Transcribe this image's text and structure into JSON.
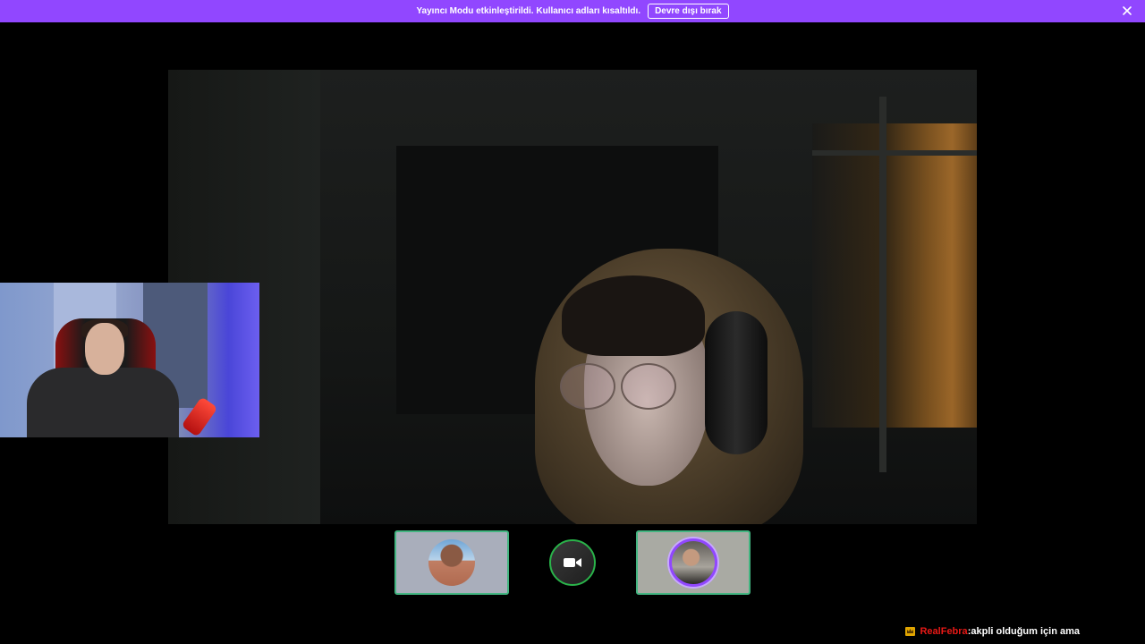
{
  "banner": {
    "message": "Yayıncı Modu etkinleştirildi. Kullanıcı adları kısaltıldı.",
    "disable_label": "Devre dışı bırak",
    "close_icon": "close-icon",
    "color": "#9147ff"
  },
  "participants": [
    {
      "id": "participant-1",
      "speaking": true
    },
    {
      "id": "participant-2",
      "video_icon": "video-camera-icon",
      "speaking": false
    },
    {
      "id": "participant-3",
      "speaking": true,
      "live_ring": "#9147ff"
    }
  ],
  "chat": {
    "badge_icon": "crown-icon",
    "username": "RealFebra",
    "separator": " :",
    "message": " akpli olduğum için ama",
    "username_color": "#e91916"
  }
}
